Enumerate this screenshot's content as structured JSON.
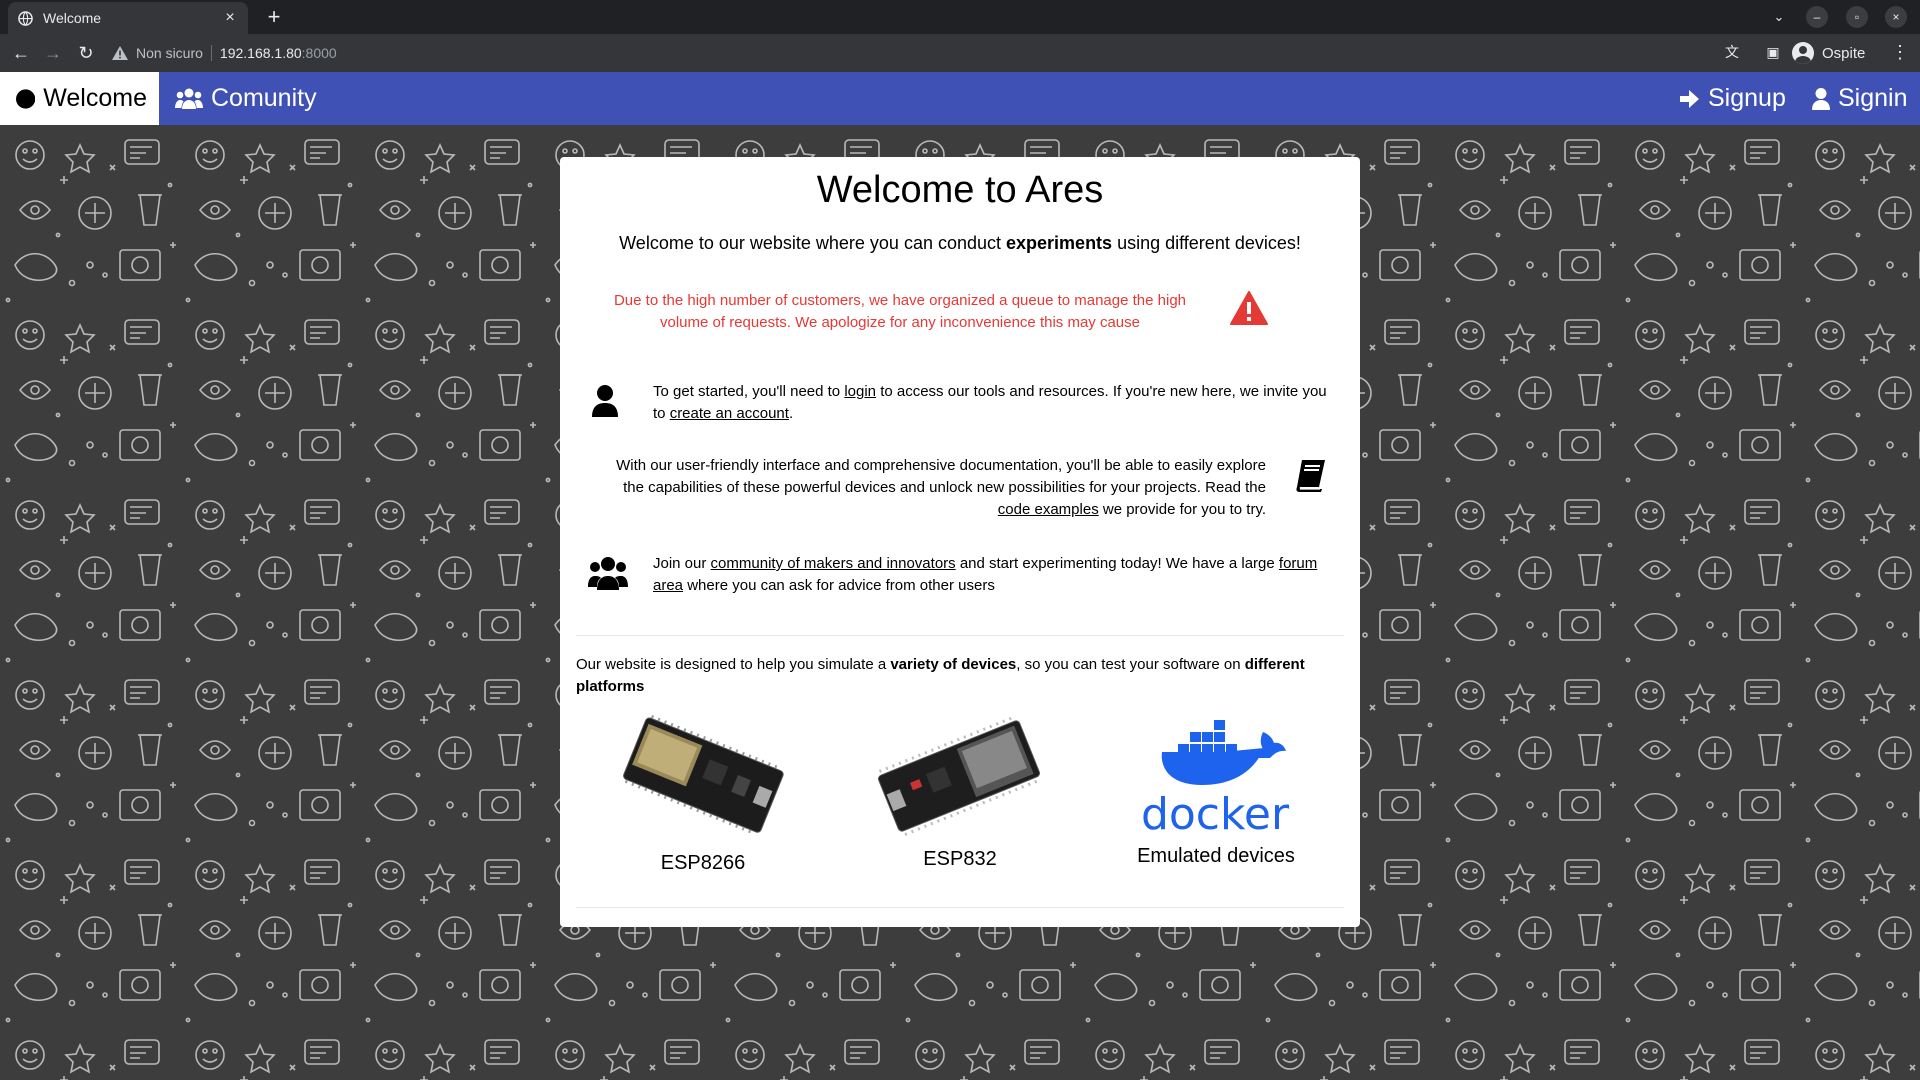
{
  "browser": {
    "tab_title": "Welcome",
    "new_tab": "+",
    "security_label": "Non sicuro",
    "url_host": "192.168.1.80",
    "url_port": ":8000",
    "profile_name": "Ospite"
  },
  "nav": {
    "welcome": "Welcome",
    "community": "Comunity",
    "signup": "Signup",
    "signin": "Signin",
    "accent_color": "#3f51b5"
  },
  "card": {
    "title": "Welcome to Ares",
    "intro_before": "Welcome to our website where you can conduct ",
    "intro_bold": "experiments",
    "intro_after": " using different devices!",
    "notice_color": "#e53935",
    "notice": "Due to the high number of customers, we have organized a queue to manage the high volume of requests. We apologize for any inconvenience this may cause",
    "start": {
      "t1": "To get started, you'll need to ",
      "link_login": "login",
      "t2": " to access our tools and resources. If you're new here, we invite you to ",
      "link_create": "create an account",
      "t3": "."
    },
    "docs": {
      "t1": "With our user-friendly interface and comprehensive documentation, you'll be able to easily explore the capabilities of these powerful devices and unlock new possibilities for your projects. Read the ",
      "link_examples": "code examples",
      "t2": " we provide for you to try."
    },
    "community": {
      "t1": "Join our ",
      "link_community": "community of makers and innovators",
      "t2": " and start experimenting today! We have a large ",
      "link_forum": "forum area",
      "t3": " where you can ask for advice from other users"
    },
    "designed": {
      "t1": "Our website is designed to help you simulate a ",
      "b1": "variety of devices",
      "t2": ", so you can test your software on ",
      "b2": "different platforms"
    },
    "devices": [
      {
        "name": "ESP8266"
      },
      {
        "name": "ESP832"
      },
      {
        "name": "Emulated devices",
        "logo_text": "docker"
      }
    ]
  }
}
